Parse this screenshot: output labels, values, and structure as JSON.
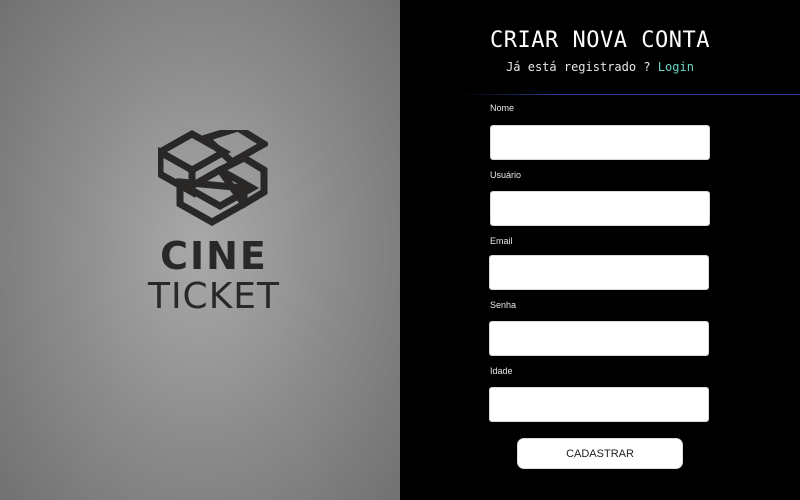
{
  "logo": {
    "icon": "cine-ticket-logo-icon",
    "line1": "CINE",
    "line2": "TICKET"
  },
  "form": {
    "title": "CRIAR NOVA CONTA",
    "subtitle": "Já está registrado ?",
    "login_link": "Login",
    "fields": [
      {
        "label": "Nome",
        "value": ""
      },
      {
        "label": "Usuário",
        "value": ""
      },
      {
        "label": "Email",
        "value": ""
      },
      {
        "label": "Senha",
        "value": ""
      },
      {
        "label": "Idade",
        "value": ""
      }
    ],
    "submit_label": "CADASTRAR"
  },
  "colors": {
    "left_bg": "#8c8c8c",
    "right_bg": "#000000",
    "accent_link": "#6bd3c5",
    "divider": "#2b3f9a",
    "logo_dark": "#2a2727"
  }
}
